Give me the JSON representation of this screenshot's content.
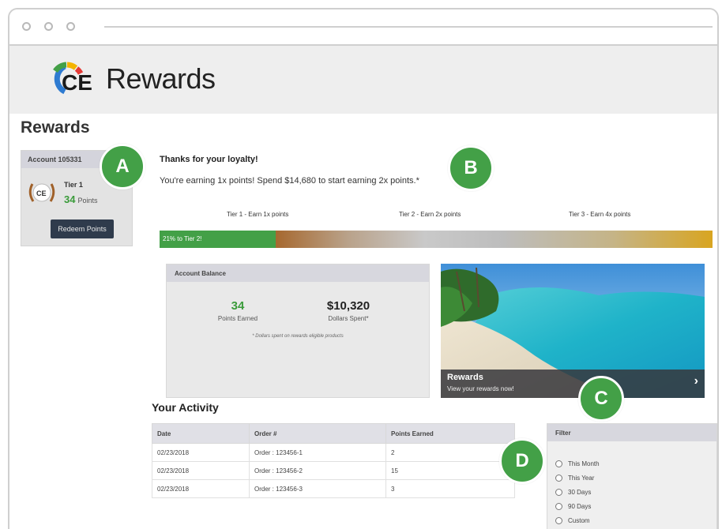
{
  "brand": {
    "logo_text": "Rewards",
    "accent": "#43a047",
    "dark": "#2f3b4c"
  },
  "page": {
    "title": "Rewards"
  },
  "account": {
    "label": "Account 105331",
    "tier": "Tier 1",
    "points": "34",
    "points_unit": "Points",
    "redeem_label": "Redeem Points"
  },
  "loyalty": {
    "title": "Thanks for your loyalty!",
    "message": "You're earning 1x points! Spend $14,680 to start earning 2x points.*"
  },
  "tiers": [
    {
      "label": "Tier 1 - Earn 1x points"
    },
    {
      "label": "Tier 2 - Earn 2x points"
    },
    {
      "label": "Tier 3 - Earn 4x points"
    }
  ],
  "progress": {
    "label": "21% to Tier 2!",
    "fraction": 0.21
  },
  "balance": {
    "header": "Account Balance",
    "points_value": "34",
    "points_label": "Points Earned",
    "dollars_value": "$10,320",
    "dollars_label": "Dollars Spent*",
    "note": "* Dollars spent on rewards eligible products"
  },
  "promo": {
    "title": "Rewards",
    "subtitle": "View your rewards now!",
    "chevron": "›"
  },
  "activity": {
    "title": "Your Activity",
    "columns": [
      "Date",
      "Order #",
      "Points Earned"
    ],
    "rows": [
      [
        "02/23/2018",
        "Order : 123456-1",
        "2"
      ],
      [
        "02/23/2018",
        "Order : 123456-2",
        "15"
      ],
      [
        "02/23/2018",
        "Order : 123456-3",
        "3"
      ]
    ]
  },
  "filter": {
    "header": "Filter",
    "options": [
      "This Month",
      "This Year",
      "30 Days",
      "90 Days",
      "Custom"
    ]
  },
  "markers": [
    "A",
    "B",
    "C",
    "D"
  ]
}
